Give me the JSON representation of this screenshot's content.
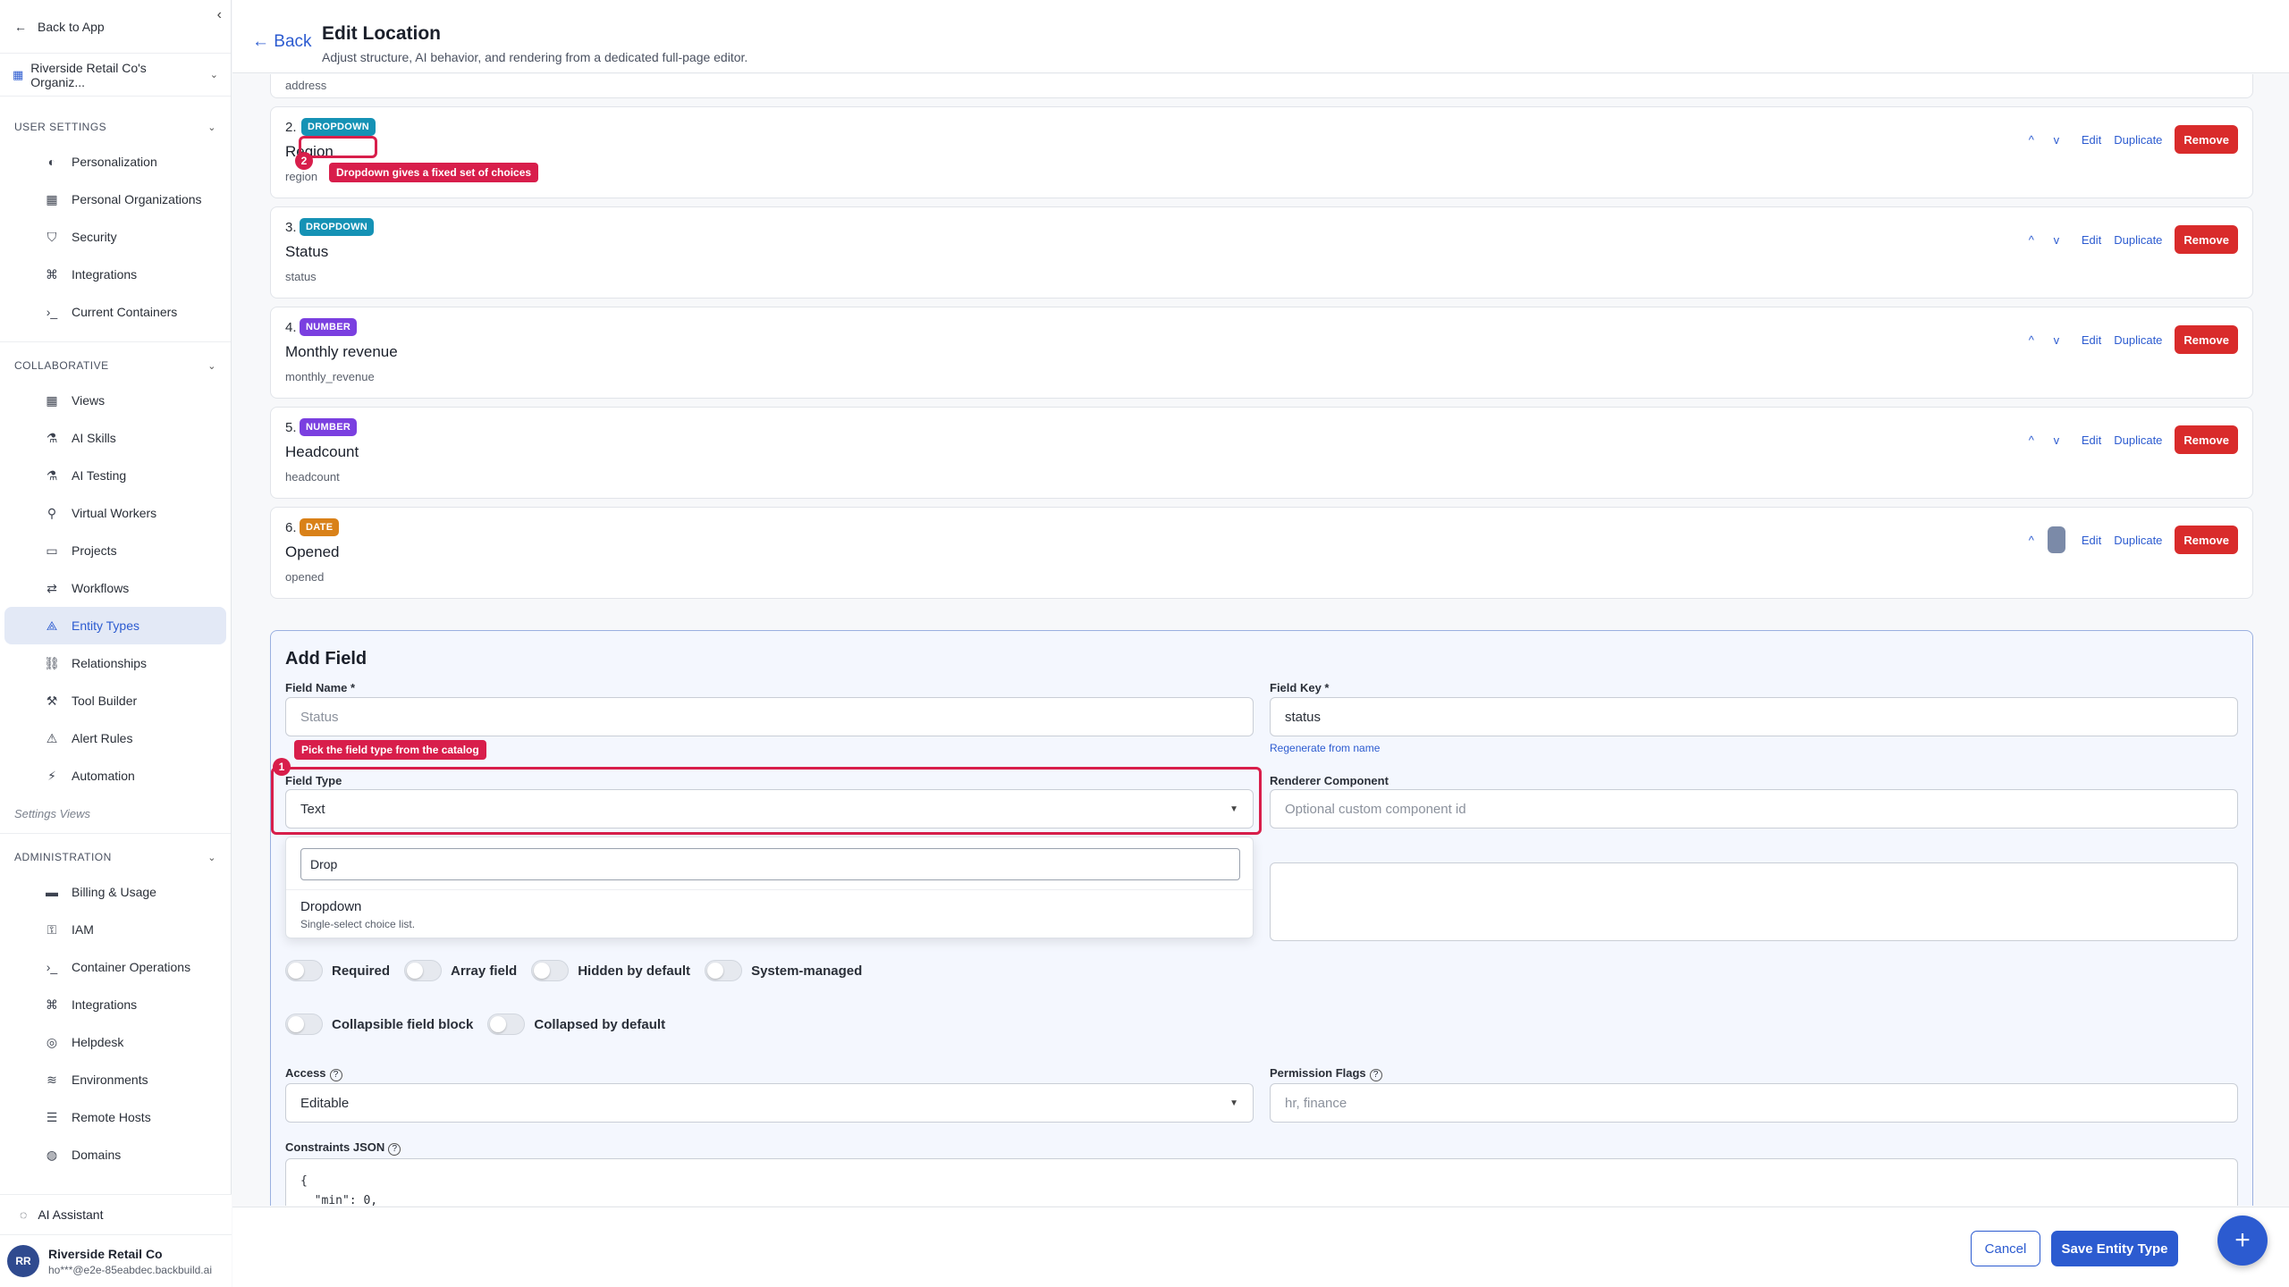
{
  "sidebar": {
    "back_label": "Back to App",
    "org_name": "Riverside Retail Co's Organiz...",
    "user_settings": {
      "title": "USER SETTINGS",
      "items": [
        {
          "label": "Personalization",
          "icon": "palette-icon"
        },
        {
          "label": "Personal Organizations",
          "icon": "building-icon"
        },
        {
          "label": "Security",
          "icon": "shield-icon"
        },
        {
          "label": "Integrations",
          "icon": "plug-icon"
        },
        {
          "label": "Current Containers",
          "icon": "terminal-icon"
        }
      ]
    },
    "collaborative": {
      "title": "COLLABORATIVE",
      "items": [
        {
          "label": "Views",
          "icon": "grid-icon"
        },
        {
          "label": "AI Skills",
          "icon": "flask-icon"
        },
        {
          "label": "AI Testing",
          "icon": "beaker-icon"
        },
        {
          "label": "Virtual Workers",
          "icon": "person-icon"
        },
        {
          "label": "Projects",
          "icon": "briefcase-icon"
        },
        {
          "label": "Workflows",
          "icon": "arrows-icon"
        },
        {
          "label": "Entity Types",
          "icon": "shapes-icon"
        },
        {
          "label": "Relationships",
          "icon": "link-icon"
        },
        {
          "label": "Tool Builder",
          "icon": "hammer-icon"
        },
        {
          "label": "Alert Rules",
          "icon": "alert-icon"
        },
        {
          "label": "Automation",
          "icon": "bolt-icon"
        }
      ]
    },
    "settings_views_label": "Settings Views",
    "administration": {
      "title": "ADMINISTRATION",
      "items": [
        {
          "label": "Billing & Usage",
          "icon": "card-icon"
        },
        {
          "label": "IAM",
          "icon": "key-icon"
        },
        {
          "label": "Container Operations",
          "icon": "terminal-icon"
        },
        {
          "label": "Integrations",
          "icon": "plug-icon"
        },
        {
          "label": "Helpdesk",
          "icon": "lifebuoy-icon"
        },
        {
          "label": "Environments",
          "icon": "layers-icon"
        },
        {
          "label": "Remote Hosts",
          "icon": "server-icon"
        },
        {
          "label": "Domains",
          "icon": "globe-icon"
        }
      ]
    },
    "ai_assistant_label": "AI Assistant",
    "user": {
      "initials": "RR",
      "name": "Riverside Retail Co",
      "email": "ho***@e2e-85eabdec.backbuild.ai"
    }
  },
  "header": {
    "back_label": "← Back",
    "title": "Edit Location",
    "subtitle": "Adjust structure, AI behavior, and rendering from a dedicated full-page editor."
  },
  "partial_field": {
    "key": "address"
  },
  "fields": [
    {
      "num": "2.",
      "type": "DROPDOWN",
      "name": "Region",
      "key": "region"
    },
    {
      "num": "3.",
      "type": "DROPDOWN",
      "name": "Status",
      "key": "status"
    },
    {
      "num": "4.",
      "type": "NUMBER",
      "name": "Monthly revenue",
      "key": "monthly_revenue"
    },
    {
      "num": "5.",
      "type": "NUMBER",
      "name": "Headcount",
      "key": "headcount"
    },
    {
      "num": "6.",
      "type": "DATE",
      "name": "Opened",
      "key": "opened"
    }
  ],
  "field_actions": {
    "up": "^",
    "down": "v",
    "edit": "Edit",
    "duplicate": "Duplicate",
    "remove": "Remove"
  },
  "annotations": {
    "one": {
      "num": "1",
      "text": "Pick the field type from the catalog"
    },
    "two": {
      "num": "2",
      "text": "Dropdown gives a fixed set of choices"
    }
  },
  "add_field": {
    "title": "Add Field",
    "field_name_label": "Field Name *",
    "field_name_placeholder": "Status",
    "field_key_label": "Field Key *",
    "field_key_value": "status",
    "regenerate_label": "Regenerate from name",
    "field_type_label": "Field Type",
    "field_type_value": "Text",
    "renderer_label": "Renderer Component",
    "renderer_placeholder": "Optional custom component id",
    "dropdown_search": "Drop",
    "dropdown_option_title": "Dropdown",
    "dropdown_option_desc": "Single-select choice list.",
    "toggles_row1": [
      "Required",
      "Array field",
      "Hidden by default",
      "System-managed"
    ],
    "toggles_row2": [
      "Collapsible field block",
      "Collapsed by default"
    ],
    "access_label": "Access",
    "access_value": "Editable",
    "permission_label": "Permission Flags",
    "permission_placeholder": "hr, finance",
    "constraints_label": "Constraints JSON",
    "constraints_value": "{\n  \"min\": 0,"
  },
  "footer": {
    "cancel_label": "Cancel",
    "save_label": "Save Entity Type",
    "fab_label": "+"
  },
  "colors": {
    "accent": "#2c5bd0",
    "remove": "#d92b2b",
    "annotation": "#d81e4b",
    "dropdown_badge": "#1592b5",
    "number_badge": "#7a3fe0",
    "date_badge": "#d98118"
  }
}
